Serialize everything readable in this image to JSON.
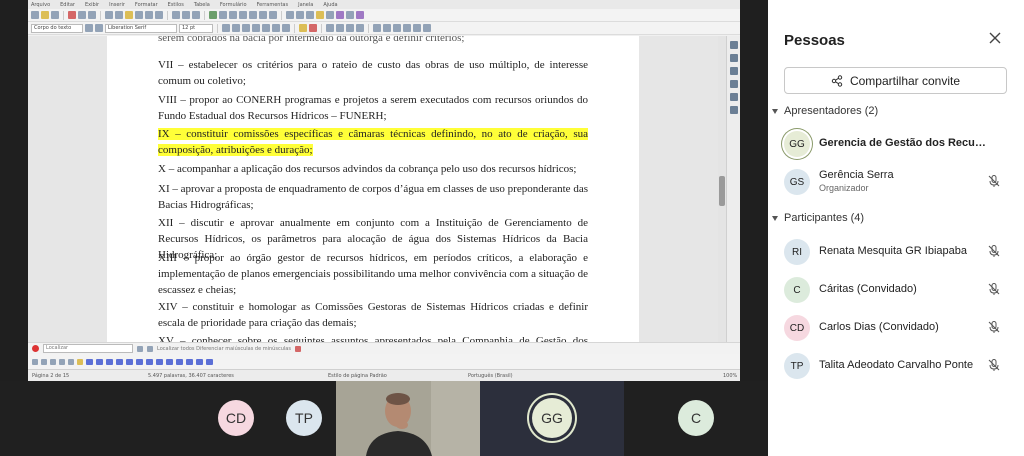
{
  "writer": {
    "menus": [
      "Arquivo",
      "Editar",
      "Exibir",
      "Inserir",
      "Formatar",
      "Estilos",
      "Tabela",
      "Formulário",
      "Ferramentas",
      "Janela",
      "Ajuda"
    ],
    "paragraph_style": "Corpo do texto",
    "font_name": "Liberation Serif",
    "font_size": "12 pt",
    "paragraphs": [
      {
        "text": "serem cobrados na bacia por intermédio da outorga e definir critérios;",
        "highlight": false
      },
      {
        "text": "VII – estabelecer os critérios para o rateio de custo das obras de uso múltiplo, de interesse comum ou coletivo;",
        "highlight": false
      },
      {
        "text": "VIII – propor ao CONERH programas e projetos a serem executados com recursos oriundos do Fundo Estadual dos Recursos Hídricos – FUNERH;",
        "highlight": false
      },
      {
        "text": "IX – constituir comissões específicas e câmaras técnicas definindo, no ato de criação, sua composição, atribuições e duração;",
        "highlight": true
      },
      {
        "text": "X – acompanhar a aplicação dos recursos advindos da cobrança pelo uso dos recursos hídricos;",
        "highlight": false
      },
      {
        "text": "XI – aprovar a proposta de enquadramento de corpos d’água em classes de uso preponderante das Bacias Hidrográficas;",
        "highlight": false
      },
      {
        "text": "XII – discutir e aprovar anualmente em conjunto com a Instituição de Gerenciamento de Recursos Hídricos, os parâmetros para alocação de água dos Sistemas Hídricos da Bacia Hidrográfica;",
        "highlight": false
      },
      {
        "text": "XIII – propor ao órgão gestor de recursos hídricos, em períodos críticos, a elaboração e implementação de planos emergenciais possibilitando uma melhor convivência com a situação de escassez e cheias;",
        "highlight": false
      },
      {
        "text": "XIV – constituir e homologar as Comissões Gestoras de Sistemas Hídricos criadas e definir escala de prioridade para criação das demais;",
        "highlight": false
      },
      {
        "text": "XV – conhecer sobre os seguintes assuntos apresentados pela Companhia de Gestão dos Recursos",
        "highlight": false
      }
    ],
    "find_placeholder": "Localizar",
    "find_options": "Localizar todos   Diferenciar maiúsculas de minúsculas",
    "status": {
      "page": "Página 2 de 15",
      "words": "5.497 palavras, 36.407 caracteres",
      "page_style": "Estilo de página Padrão",
      "language": "Português (Brasil)",
      "zoom": "100%"
    }
  },
  "people": {
    "title": "Pessoas",
    "share_label": "Compartilhar convite",
    "presenters_label": "Apresentadores (2)",
    "participants_label": "Participantes (4)",
    "presenters": [
      {
        "initials": "GG",
        "name": "Gerencia de Gestão dos Recursos Hídricos",
        "role": "",
        "bold": true,
        "color": "#e6ecd6"
      },
      {
        "initials": "GS",
        "name": "Gerência Serra",
        "role": "Organizador",
        "bold": false,
        "color": "#dbe6ee"
      }
    ],
    "participants": [
      {
        "initials": "RI",
        "name": "Renata Mesquita GR Ibiapaba",
        "color": "#dbe6ee"
      },
      {
        "initials": "C",
        "name": "Cáritas (Convidado)",
        "color": "#dcebdc"
      },
      {
        "initials": "CD",
        "name": "Carlos Dias (Convidado)",
        "color": "#f6d8e0"
      },
      {
        "initials": "TP",
        "name": "Talita Adeodato Carvalho Ponte",
        "color": "#dbe6ee"
      }
    ]
  },
  "strip": {
    "tiles": [
      {
        "initials": "CD",
        "color": "#f6d8e0"
      },
      {
        "initials": "TP",
        "color": "#dbe6ee"
      },
      {
        "initials": "GG",
        "color": "#e6ecd6"
      },
      {
        "initials": "C",
        "color": "#dcebdc"
      }
    ]
  }
}
